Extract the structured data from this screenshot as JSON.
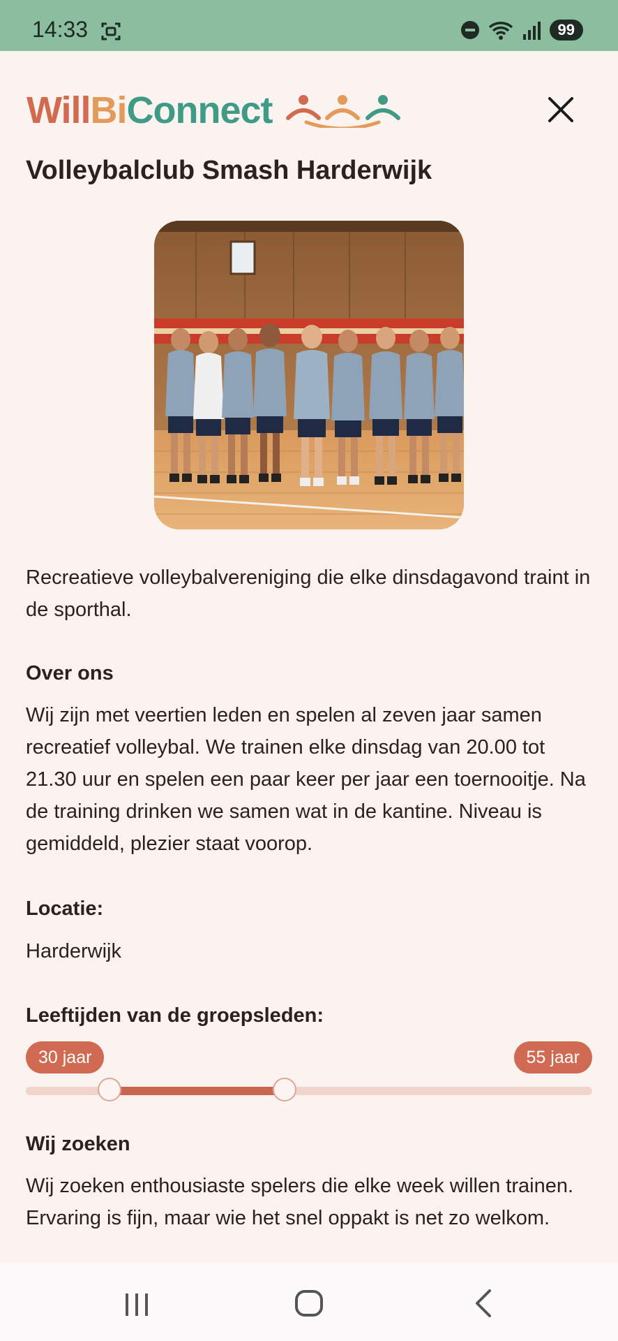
{
  "status_bar": {
    "time": "14:33",
    "battery": "99",
    "icons": [
      "screenshot-icon",
      "do-not-disturb-icon",
      "wifi-icon",
      "signal-icon",
      "battery-icon"
    ]
  },
  "header": {
    "logo_parts": [
      "Will",
      "Bi",
      "Connect"
    ],
    "logo_colors": [
      "#d16a4e",
      "#e49a5a",
      "#3f9a86"
    ],
    "close_icon": "close-icon"
  },
  "group": {
    "title": "Volleybalclub Smash Harderwijk",
    "image_icon": "team-photo",
    "summary": "Recreatieve volleybalvereniging die elke dinsdagavond traint in de sporthal.",
    "about_heading": "Over ons",
    "about_text": "Wij zijn met veertien leden en spelen al zeven jaar samen recreatief volleybal. We trainen elke dinsdag van 20.00 tot 21.30 uur en spelen een paar keer per jaar een toernooitje. Na de training drinken we samen wat in de kantine. Niveau is gemiddeld, plezier staat voorop.",
    "location_heading": "Locatie:",
    "location_value": "Harderwijk",
    "ages_heading": "Leeftijden van de groepsleden:",
    "age_min_label": "30 jaar",
    "age_max_label": "55 jaar",
    "age_min_value": 30,
    "age_max_value": 55,
    "seeking_heading": "Wij zoeken",
    "seeking_text": "Wij zoeken enthousiaste spelers die elke week willen trainen. Ervaring is fijn, maar wie het snel oppakt is net zo welkom."
  },
  "colors": {
    "accent": "#d16a52",
    "status_bar": "#8bbd9f",
    "background": "#faf3ef"
  },
  "nav_bar": {
    "icons": [
      "recent-apps-icon",
      "home-icon",
      "back-icon"
    ]
  }
}
